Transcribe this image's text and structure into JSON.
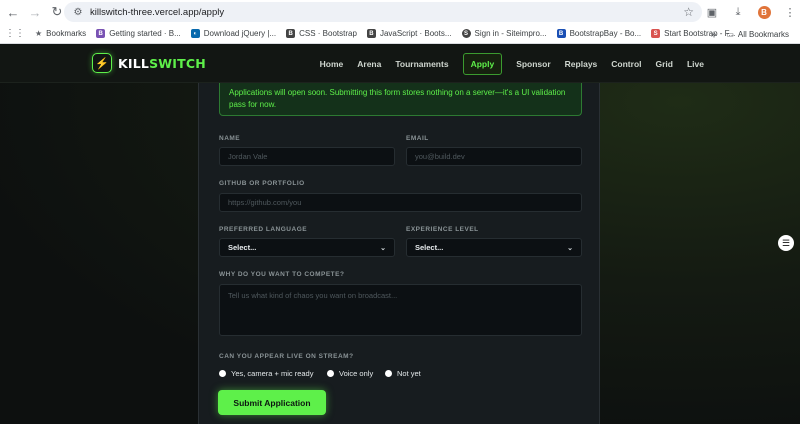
{
  "browser": {
    "url": "killswitch-three.vercel.app/apply",
    "profile_initial": "B",
    "bookmarks": [
      {
        "label": "Bookmarks",
        "icon": "star-icon",
        "color": "#3c4043"
      },
      {
        "label": "Getting started · B...",
        "icon": "bootstrap-icon",
        "color": "#7952b3"
      },
      {
        "label": "Download jQuery |...",
        "icon": "jquery-icon",
        "color": "#0769ad"
      },
      {
        "label": "CSS · Bootstrap",
        "icon": "bootstrap-icon",
        "color": "#444"
      },
      {
        "label": "JavaScript · Boots...",
        "icon": "bootstrap-icon",
        "color": "#444"
      },
      {
        "label": "Sign in - Siteimpro...",
        "icon": "siteimprove-icon",
        "color": "#444"
      },
      {
        "label": "BootstrapBay - Bo...",
        "icon": "bootstrapbay-icon",
        "color": "#1a4fb4"
      },
      {
        "label": "Start Bootstrap - F...",
        "icon": "startbootstrap-icon",
        "color": "#d9534f"
      }
    ],
    "all_bookmarks": "All Bookmarks"
  },
  "site": {
    "logo_a": "KILL",
    "logo_b": "SWITCH",
    "nav": [
      "Home",
      "Arena",
      "Tournaments",
      "Apply",
      "Sponsor",
      "Replays",
      "Control",
      "Grid",
      "Live"
    ],
    "active_nav": "Apply"
  },
  "form": {
    "alert": "Applications will open soon. Submitting this form stores nothing on a server—it's a UI validation pass for now.",
    "name_label": "NAME",
    "name_placeholder": "Jordan Vale",
    "email_label": "EMAIL",
    "email_placeholder": "you@build.dev",
    "github_label": "GITHUB OR PORTFOLIO",
    "github_placeholder": "https://github.com/you",
    "language_label": "PREFERRED LANGUAGE",
    "language_value": "Select...",
    "experience_label": "EXPERIENCE LEVEL",
    "experience_value": "Select...",
    "why_label": "WHY DO YOU WANT TO COMPETE?",
    "why_placeholder": "Tell us what kind of chaos you want on broadcast...",
    "stream_label": "CAN YOU APPEAR LIVE ON STREAM?",
    "stream_options": [
      "Yes, camera + mic ready",
      "Voice only",
      "Not yet"
    ],
    "submit": "Submit Application"
  },
  "colors": {
    "accent": "#5ef04a",
    "background": "#0f1412",
    "panel": "#171c1f"
  }
}
